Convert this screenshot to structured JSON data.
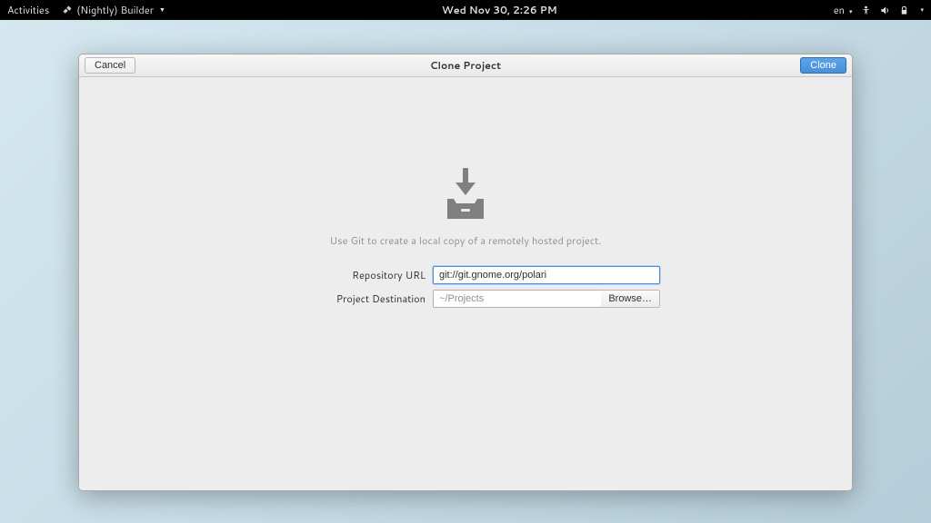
{
  "topbar": {
    "activities": "Activities",
    "app_name": "(Nightly) Builder",
    "datetime": "Wed Nov 30,  2:26 PM",
    "input_lang": "en"
  },
  "header": {
    "cancel": "Cancel",
    "title": "Clone Project",
    "clone": "Clone"
  },
  "main": {
    "subtitle": "Use Git to create a local copy of a remotely hosted project.",
    "repo_label": "Repository URL",
    "repo_value": "git://git.gnome.org/polari",
    "dest_label": "Project Destination",
    "dest_placeholder": "~/Projects",
    "browse": "Browse…"
  }
}
